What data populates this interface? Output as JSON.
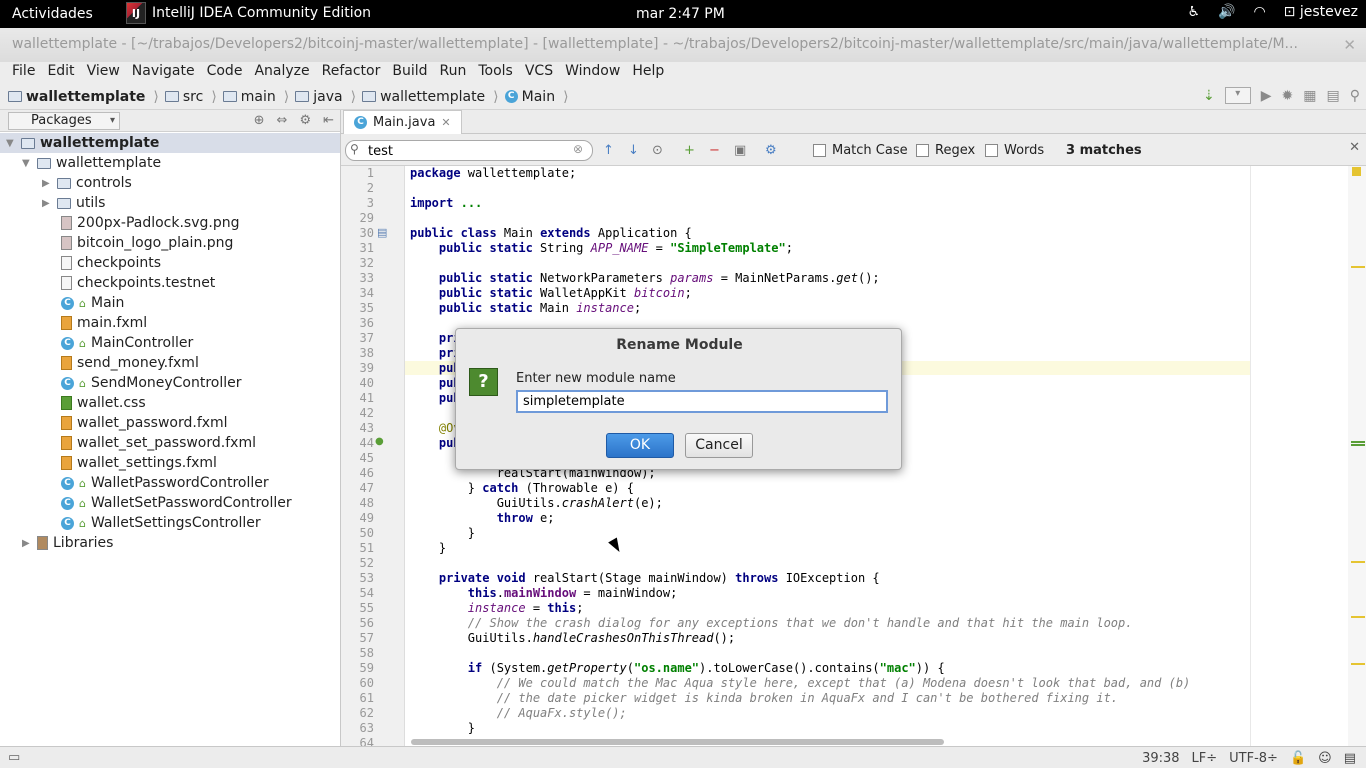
{
  "topbar": {
    "activities": "Actividades",
    "app_name": "IntelliJ IDEA Community Edition",
    "app_icon": "IJ",
    "clock": "mar  2:47 PM",
    "user": "jestevez"
  },
  "window": {
    "title": "wallettemplate - [~/trabajos/Developers2/bitcoinj-master/wallettemplate] - [wallettemplate] - ~/trabajos/Developers2/bitcoinj-master/wallettemplate/src/main/java/wallettemplate/M..."
  },
  "menu": [
    "File",
    "Edit",
    "View",
    "Navigate",
    "Code",
    "Analyze",
    "Refactor",
    "Build",
    "Run",
    "Tools",
    "VCS",
    "Window",
    "Help"
  ],
  "breadcrumb": [
    "wallettemplate",
    "src",
    "main",
    "java",
    "wallettemplate",
    "Main"
  ],
  "project_panel": {
    "view_selector": "Packages",
    "root": "wallettemplate",
    "items": [
      {
        "label": "wallettemplate",
        "kind": "package",
        "depth": 1,
        "arrow": "▼"
      },
      {
        "label": "controls",
        "kind": "folder",
        "depth": 2,
        "arrow": "▶"
      },
      {
        "label": "utils",
        "kind": "folder",
        "depth": 2,
        "arrow": "▶"
      },
      {
        "label": "200px-Padlock.svg.png",
        "kind": "img",
        "depth": 2
      },
      {
        "label": "bitcoin_logo_plain.png",
        "kind": "img",
        "depth": 2
      },
      {
        "label": "checkpoints",
        "kind": "file",
        "depth": 2
      },
      {
        "label": "checkpoints.testnet",
        "kind": "file",
        "depth": 2
      },
      {
        "label": "Main",
        "kind": "class",
        "depth": 2
      },
      {
        "label": "main.fxml",
        "kind": "xml",
        "depth": 2
      },
      {
        "label": "MainController",
        "kind": "class",
        "depth": 2
      },
      {
        "label": "send_money.fxml",
        "kind": "xml",
        "depth": 2
      },
      {
        "label": "SendMoneyController",
        "kind": "class",
        "depth": 2
      },
      {
        "label": "wallet.css",
        "kind": "css",
        "depth": 2
      },
      {
        "label": "wallet_password.fxml",
        "kind": "xml",
        "depth": 2
      },
      {
        "label": "wallet_set_password.fxml",
        "kind": "xml",
        "depth": 2
      },
      {
        "label": "wallet_settings.fxml",
        "kind": "xml",
        "depth": 2
      },
      {
        "label": "WalletPasswordController",
        "kind": "class",
        "depth": 2
      },
      {
        "label": "WalletSetPasswordController",
        "kind": "class",
        "depth": 2
      },
      {
        "label": "WalletSettingsController",
        "kind": "class",
        "depth": 2
      },
      {
        "label": "Libraries",
        "kind": "lib",
        "depth": 1,
        "arrow": "▶"
      }
    ]
  },
  "editor": {
    "tab": "Main.java",
    "find": {
      "query": "test",
      "match_case": "Match Case",
      "regex": "Regex",
      "words": "Words",
      "matches": "3 matches"
    },
    "lines": [
      {
        "n": "1",
        "html": "<span class=\"kw\">package</span> wallettemplate;"
      },
      {
        "n": "2",
        "html": ""
      },
      {
        "n": "3",
        "html": "<span class=\"kw\">import</span> <span class=\"str\">...</span>"
      },
      {
        "n": "29",
        "html": ""
      },
      {
        "n": "30",
        "html": "<span class=\"kw\">public class</span> Main <span class=\"kw\">extends</span> Application {"
      },
      {
        "n": "31",
        "html": "    <span class=\"kw\">public static</span> String <span class=\"it\">APP_NAME</span> = <span class=\"str\">\"SimpleTemplate\"</span>;"
      },
      {
        "n": "32",
        "html": ""
      },
      {
        "n": "33",
        "html": "    <span class=\"kw\">public static</span> NetworkParameters <span class=\"it\">params</span> = MainNetParams.<span class=\"st\">get</span>();"
      },
      {
        "n": "34",
        "html": "    <span class=\"kw\">public static</span> WalletAppKit <span class=\"it\">bitcoin</span>;"
      },
      {
        "n": "35",
        "html": "    <span class=\"kw\">public static</span> Main <span class=\"it\">instance</span>;"
      },
      {
        "n": "36",
        "html": ""
      },
      {
        "n": "37",
        "html": "    <span class=\"kw\">pri</span>"
      },
      {
        "n": "38",
        "html": "    <span class=\"kw\">pri</span>"
      },
      {
        "n": "39",
        "html": "    <span class=\"kw\">pub</span>"
      },
      {
        "n": "40",
        "html": "    <span class=\"kw\">pub</span>"
      },
      {
        "n": "41",
        "html": "    <span class=\"kw\">pub</span>"
      },
      {
        "n": "42",
        "html": ""
      },
      {
        "n": "43",
        "html": "    <span class=\"an\">@Ov</span>"
      },
      {
        "n": "44",
        "html": "    <span class=\"kw\">pub</span>"
      },
      {
        "n": "45",
        "html": ""
      },
      {
        "n": "46",
        "html": "            realStart(mainWindow);"
      },
      {
        "n": "47",
        "html": "        } <span class=\"kw\">catch</span> (Throwable e) {"
      },
      {
        "n": "48",
        "html": "            GuiUtils.<span class=\"st\">crashAlert</span>(e);"
      },
      {
        "n": "49",
        "html": "            <span class=\"kw\">throw</span> e;"
      },
      {
        "n": "50",
        "html": "        }"
      },
      {
        "n": "51",
        "html": "    }"
      },
      {
        "n": "52",
        "html": ""
      },
      {
        "n": "53",
        "html": "    <span class=\"kw\">private void</span> realStart(Stage mainWindow) <span class=\"kw\">throws</span> IOException {"
      },
      {
        "n": "54",
        "html": "        <span class=\"kw\">this</span>.<span class=\"it\" style=\"color:#660e7a;font-style:normal;font-weight:bold\">mainWindow</span> = mainWindow;"
      },
      {
        "n": "55",
        "html": "        <span class=\"it\">instance</span> = <span class=\"kw\">this</span>;"
      },
      {
        "n": "56",
        "html": "        <span class=\"cm\">// Show the crash dialog for any exceptions that we don't handle and that hit the main loop.</span>"
      },
      {
        "n": "57",
        "html": "        GuiUtils.<span class=\"st\">handleCrashesOnThisThread</span>();"
      },
      {
        "n": "58",
        "html": ""
      },
      {
        "n": "59",
        "html": "        <span class=\"kw\">if</span> (System.<span class=\"st\">getProperty</span>(<span class=\"str\">\"os.name\"</span>).toLowerCase().contains(<span class=\"str\">\"mac\"</span>)) {"
      },
      {
        "n": "60",
        "html": "            <span class=\"cm\">// We could match the Mac Aqua style here, except that (a) Modena doesn't look that bad, and (b)</span>"
      },
      {
        "n": "61",
        "html": "            <span class=\"cm\">// the date picker widget is kinda broken in AquaFx and I can't be bothered fixing it.</span>"
      },
      {
        "n": "62",
        "html": "            <span class=\"cm\">// AquaFx.style();</span>"
      },
      {
        "n": "63",
        "html": "        }"
      },
      {
        "n": "64",
        "html": ""
      }
    ]
  },
  "dialog": {
    "title": "Rename Module",
    "prompt": "Enter new module name",
    "value": "simpletemplate",
    "ok": "OK",
    "cancel": "Cancel",
    "icon": "?"
  },
  "status": {
    "position": "39:38",
    "line_sep": "LF÷",
    "encoding": "UTF-8÷"
  }
}
